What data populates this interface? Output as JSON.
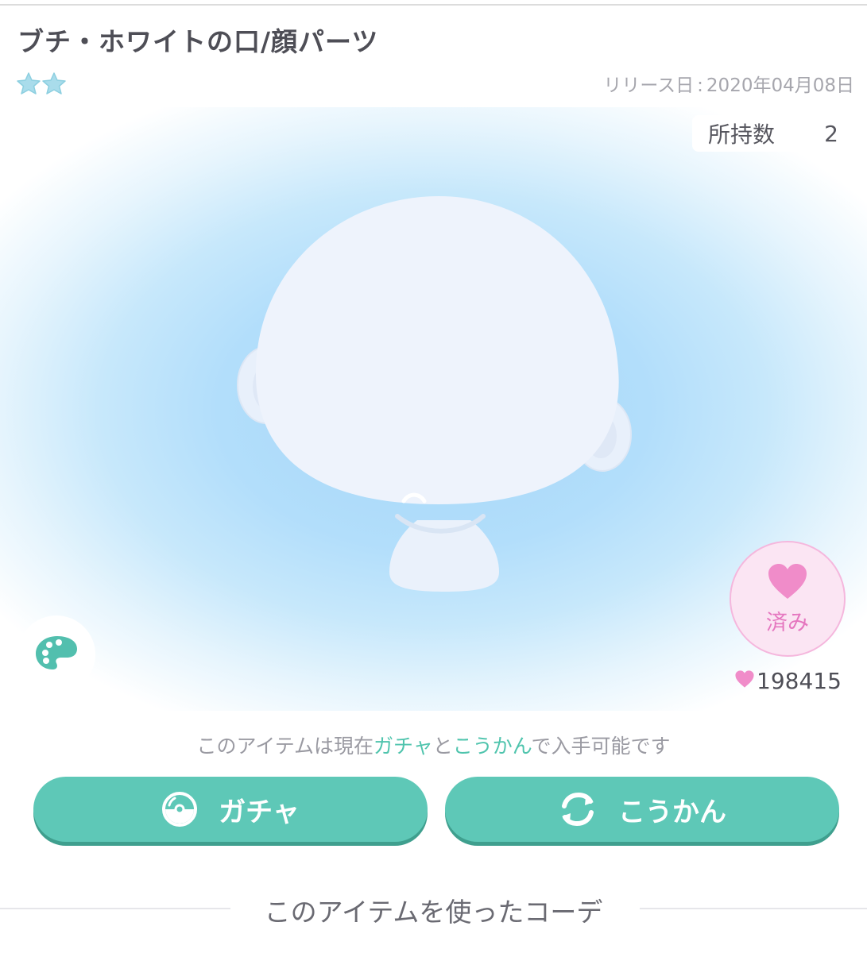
{
  "item": {
    "title": "ブチ・ホワイトの口/顔パーツ",
    "rarity_stars": 2,
    "release_label": "リリース日",
    "release_date": "2020年04月08日",
    "owned_label": "所持数",
    "owned_count": "2"
  },
  "like": {
    "status_label": "済み",
    "count": "198415"
  },
  "availability": {
    "prefix": "このアイテムは現在",
    "gacha": "ガチャ",
    "conj": "と",
    "exchange": "こうかん",
    "suffix": "で入手可能です"
  },
  "buttons": {
    "gacha_label": "ガチャ",
    "exchange_label": "こうかん"
  },
  "section": {
    "title": "このアイテムを使ったコーデ"
  },
  "colors": {
    "accent_green": "#5ec8b7",
    "like_pink": "#f08cc9",
    "star_teal": "#9fd7e6"
  },
  "icons": [
    "star-icon",
    "palette-icon",
    "heart-icon",
    "gacha-capsule-icon",
    "exchange-arrows-icon"
  ]
}
